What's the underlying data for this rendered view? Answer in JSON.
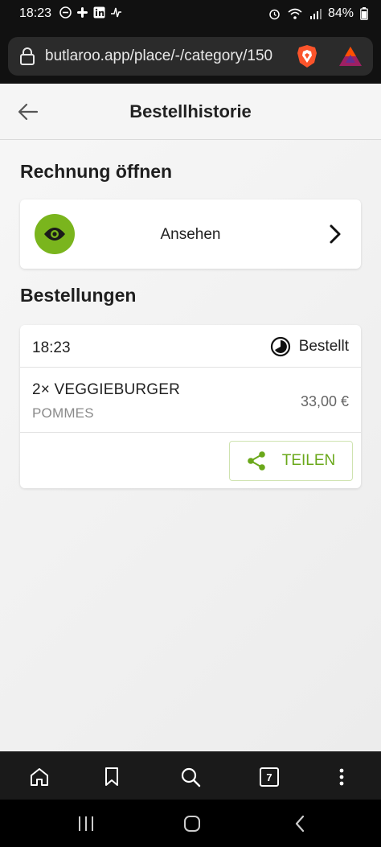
{
  "status_bar": {
    "time": "18:23",
    "battery": "84%"
  },
  "browser": {
    "url": "butlaroo.app/place/-/category/150",
    "tab_count": "7"
  },
  "header": {
    "title": "Bestellhistorie"
  },
  "invoice": {
    "section_title": "Rechnung öffnen",
    "view_label": "Ansehen"
  },
  "orders": {
    "section_title": "Bestellungen",
    "items": [
      {
        "time": "18:23",
        "status": "Bestellt",
        "product": "2× VEGGIEBURGER",
        "option": "POMMES",
        "price": "33,00 €",
        "share_label": "TEILEN"
      }
    ]
  },
  "colors": {
    "accent": "#7ab51d",
    "share_text": "#6aa81a"
  }
}
